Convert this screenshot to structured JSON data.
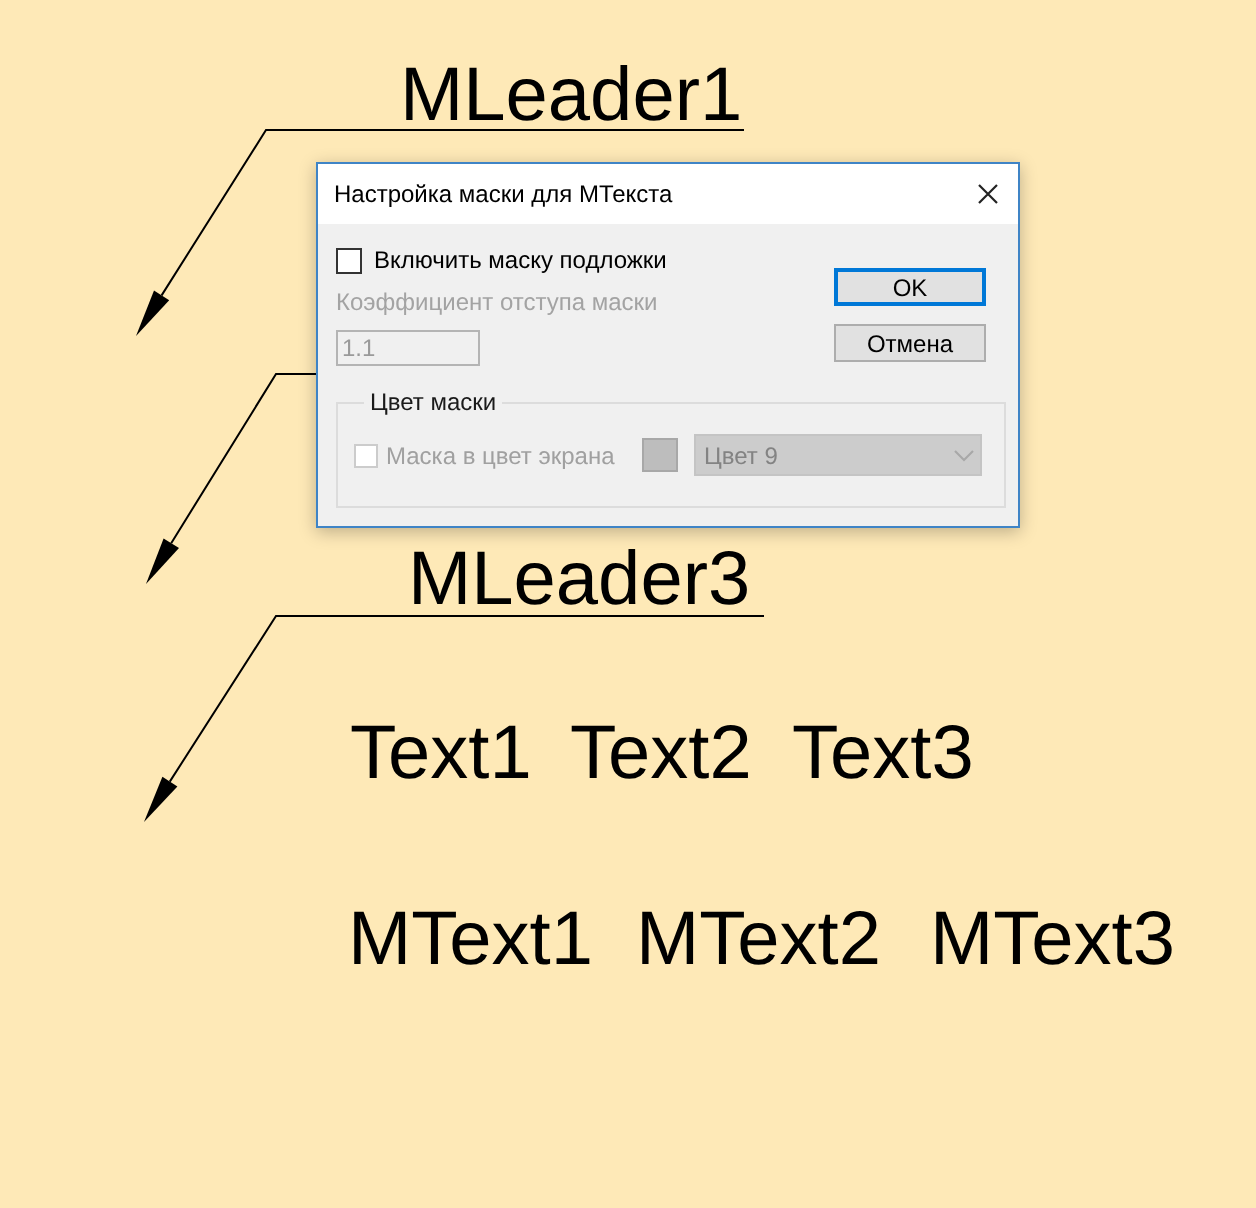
{
  "canvas": {
    "leaders": [
      {
        "kind": "labeled",
        "label": "MLeader1"
      },
      {
        "kind": "arrow_only"
      },
      {
        "kind": "labeled",
        "label": "MLeader3"
      }
    ],
    "texts": [
      "Text1",
      "Text2",
      "Text3"
    ],
    "mtexts": [
      "MText1",
      "MText2",
      "MText3"
    ]
  },
  "dialog": {
    "title": "Настройка маски для МТекста",
    "enable_mask": {
      "label": "Включить маску подложки",
      "checked": false
    },
    "offset_factor": {
      "label": "Коэффициент отступа маски",
      "value": "1.1",
      "disabled": true
    },
    "buttons": [
      {
        "label": "OK",
        "default": true
      },
      {
        "label": "Отмена",
        "default": false
      }
    ],
    "mask_color": {
      "title": "Цвет маски",
      "use_background": {
        "label": "Маска в цвет экрана",
        "checked": false,
        "disabled": true
      },
      "color": {
        "value": "Цвет 9",
        "disabled": true
      }
    }
  }
}
